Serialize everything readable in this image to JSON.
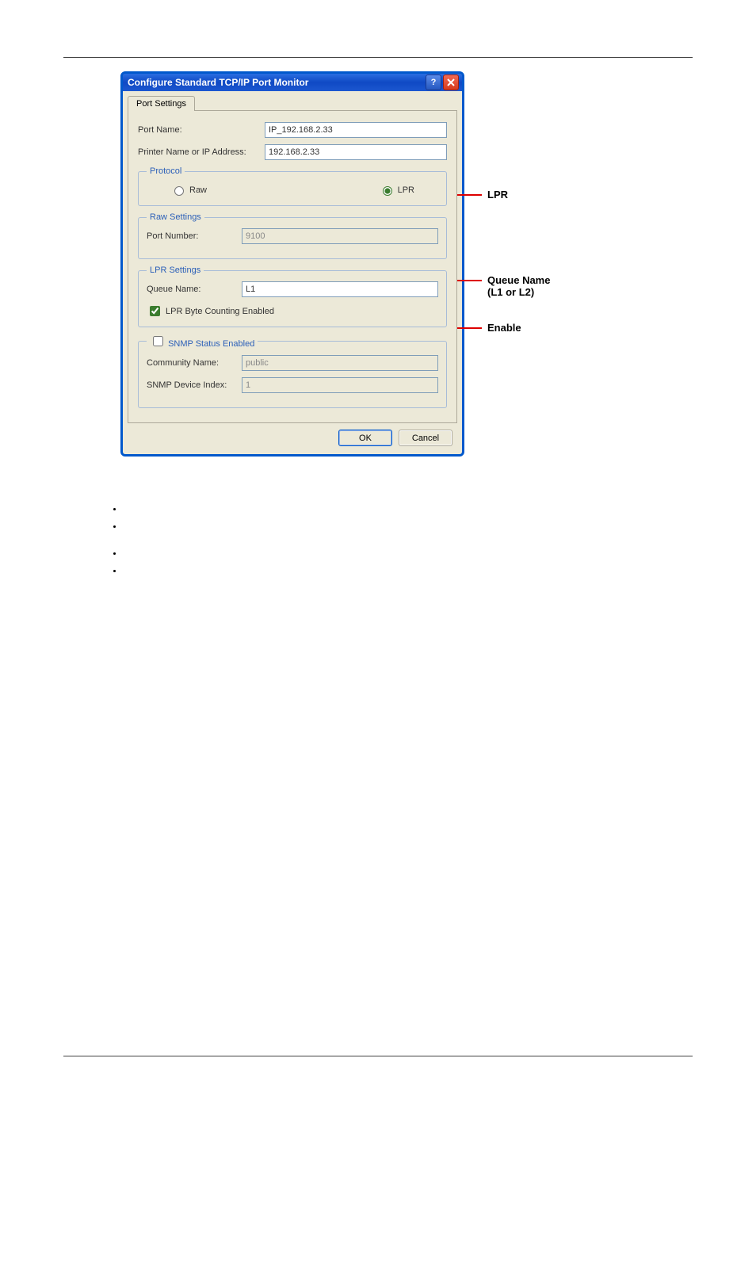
{
  "dialog": {
    "title": "Configure Standard TCP/IP Port Monitor",
    "tab": "Port Settings",
    "port_name_label": "Port Name:",
    "port_name_value": "IP_192.168.2.33",
    "printer_name_label": "Printer Name or IP Address:",
    "printer_name_value": "192.168.2.33",
    "protocol_legend": "Protocol",
    "raw_label": "Raw",
    "lpr_label": "LPR",
    "raw_settings_legend": "Raw Settings",
    "port_number_label": "Port Number:",
    "port_number_value": "9100",
    "lpr_settings_legend": "LPR Settings",
    "queue_name_label": "Queue Name:",
    "queue_name_value": "L1",
    "lpr_byte_label": "LPR Byte Counting Enabled",
    "snmp_legend": "SNMP Status Enabled",
    "community_label": "Community Name:",
    "community_value": "public",
    "snmp_index_label": "SNMP Device Index:",
    "snmp_index_value": "1",
    "ok": "OK",
    "cancel": "Cancel"
  },
  "annotations": {
    "lpr": "LPR",
    "queue_name": "Queue Name",
    "queue_name_sub": "(L1 or L2)",
    "enable": "Enable"
  }
}
